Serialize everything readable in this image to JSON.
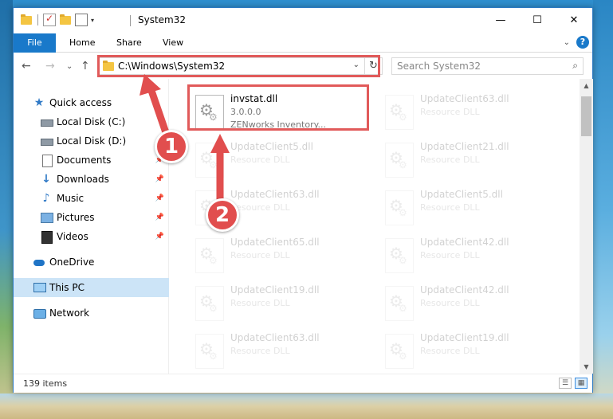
{
  "window": {
    "title": "System32",
    "controls": {
      "minimize": "—",
      "maximize": "☐",
      "close": "✕"
    }
  },
  "ribbon": {
    "tabs": [
      "File",
      "Home",
      "Share",
      "View"
    ],
    "help": "?",
    "expand": "⌄"
  },
  "addressbar": {
    "path": "C:\\Windows\\System32",
    "dropdown": "⌄",
    "refresh": "↻"
  },
  "search": {
    "placeholder": "Search System32",
    "icon": "search-icon"
  },
  "nav_buttons": {
    "back": "←",
    "forward": "→",
    "recent": "⌄",
    "up": "↑"
  },
  "sidebar": {
    "items": [
      {
        "label": "Quick access",
        "icon": "star-icon",
        "pinned": false
      },
      {
        "label": "Local Disk (C:)",
        "icon": "drive-icon",
        "pinned": false
      },
      {
        "label": "Local Disk (D:)",
        "icon": "drive-icon",
        "pinned": false
      },
      {
        "label": "Documents",
        "icon": "documents-icon",
        "pinned": true
      },
      {
        "label": "Downloads",
        "icon": "downloads-icon",
        "pinned": true
      },
      {
        "label": "Music",
        "icon": "music-icon",
        "pinned": true
      },
      {
        "label": "Pictures",
        "icon": "pictures-icon",
        "pinned": true
      },
      {
        "label": "Videos",
        "icon": "videos-icon",
        "pinned": true
      },
      {
        "label": "OneDrive",
        "icon": "onedrive-icon",
        "pinned": false
      },
      {
        "label": "This PC",
        "icon": "this-pc-icon",
        "pinned": false,
        "selected": true
      },
      {
        "label": "Network",
        "icon": "network-icon",
        "pinned": false
      }
    ],
    "pin_glyph": "📌"
  },
  "files": {
    "highlighted": {
      "name": "invstat.dll",
      "version": "3.0.0.0",
      "description": "ZENworks  Inventory..."
    },
    "faded": [
      {
        "name": "UpdateClient63.dll",
        "type": "Resource DLL"
      },
      {
        "name": "UpdateClient5.dll",
        "type": "Resource DLL"
      },
      {
        "name": "UpdateClient21.dll",
        "type": "Resource DLL"
      },
      {
        "name": "UpdateClient63.dll",
        "type": "Resource DLL"
      },
      {
        "name": "UpdateClient5.dll",
        "type": "Resource DLL"
      },
      {
        "name": "UpdateClient65.dll",
        "type": "Resource DLL"
      },
      {
        "name": "UpdateClient42.dll",
        "type": "Resource DLL"
      },
      {
        "name": "UpdateClient19.dll",
        "type": "Resource DLL"
      },
      {
        "name": "UpdateClient42.dll",
        "type": "Resource DLL"
      },
      {
        "name": "UpdateClient63.dll",
        "type": "Resource DLL"
      },
      {
        "name": "UpdateClient19.dll",
        "type": "Resource DLL"
      }
    ]
  },
  "status": {
    "item_count": "139 items"
  },
  "annotations": {
    "badge1": "1",
    "badge2": "2",
    "accent_color": "#e14e4e"
  }
}
